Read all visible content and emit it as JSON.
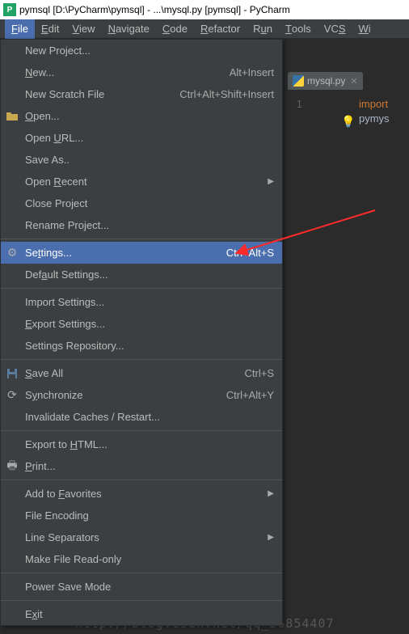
{
  "title": "pymsql [D:\\PyCharm\\pymsql] - ...\\mysql.py [pymsql] - PyCharm",
  "menubar": [
    "File",
    "Edit",
    "View",
    "Navigate",
    "Code",
    "Refactor",
    "Run",
    "Tools",
    "VCS",
    "Wi"
  ],
  "menubar_mn": [
    "F",
    "E",
    "V",
    "N",
    "C",
    "R",
    "u",
    "T",
    "S",
    "W"
  ],
  "file_menu": [
    {
      "label": "New Project..."
    },
    {
      "label": "New...",
      "mn": "N",
      "shortcut": "Alt+Insert"
    },
    {
      "label": "New Scratch File",
      "shortcut": "Ctrl+Alt+Shift+Insert"
    },
    {
      "label": "Open...",
      "mn": "O",
      "icon": "folder"
    },
    {
      "label": "Open URL...",
      "mn": "U"
    },
    {
      "label": "Save As.."
    },
    {
      "label": "Open Recent",
      "mn": "R",
      "sub": true
    },
    {
      "label": "Close Project"
    },
    {
      "label": "Rename Project..."
    },
    {
      "sep": true
    },
    {
      "label": "Settings...",
      "mn": "t",
      "shortcut": "Ctrl+Alt+S",
      "icon": "gear",
      "hl": true
    },
    {
      "label": "Default Settings...",
      "mn": "a"
    },
    {
      "sep": true
    },
    {
      "label": "Import Settings..."
    },
    {
      "label": "Export Settings...",
      "mn": "E"
    },
    {
      "label": "Settings Repository..."
    },
    {
      "sep": true
    },
    {
      "label": "Save All",
      "mn": "S",
      "shortcut": "Ctrl+S",
      "icon": "save"
    },
    {
      "label": "Synchronize",
      "mn": "y",
      "shortcut": "Ctrl+Alt+Y",
      "icon": "sync"
    },
    {
      "label": "Invalidate Caches / Restart..."
    },
    {
      "sep": true
    },
    {
      "label": "Export to HTML...",
      "mn": "H"
    },
    {
      "label": "Print...",
      "mn": "P",
      "icon": "print"
    },
    {
      "sep": true
    },
    {
      "label": "Add to Favorites",
      "mn": "F",
      "sub": true
    },
    {
      "label": "File Encoding"
    },
    {
      "label": "Line Separators",
      "sub": true
    },
    {
      "label": "Make File Read-only"
    },
    {
      "sep": true
    },
    {
      "label": "Power Save Mode"
    },
    {
      "sep": true
    },
    {
      "label": "Exit",
      "mn": "x"
    }
  ],
  "editor": {
    "tab": "mysql.py",
    "gutter": "1",
    "code_kw": "import",
    "code_rest": " pymys",
    "bulb": "💡"
  },
  "watermark": "http://blog.csdn.net/qq_36854407"
}
